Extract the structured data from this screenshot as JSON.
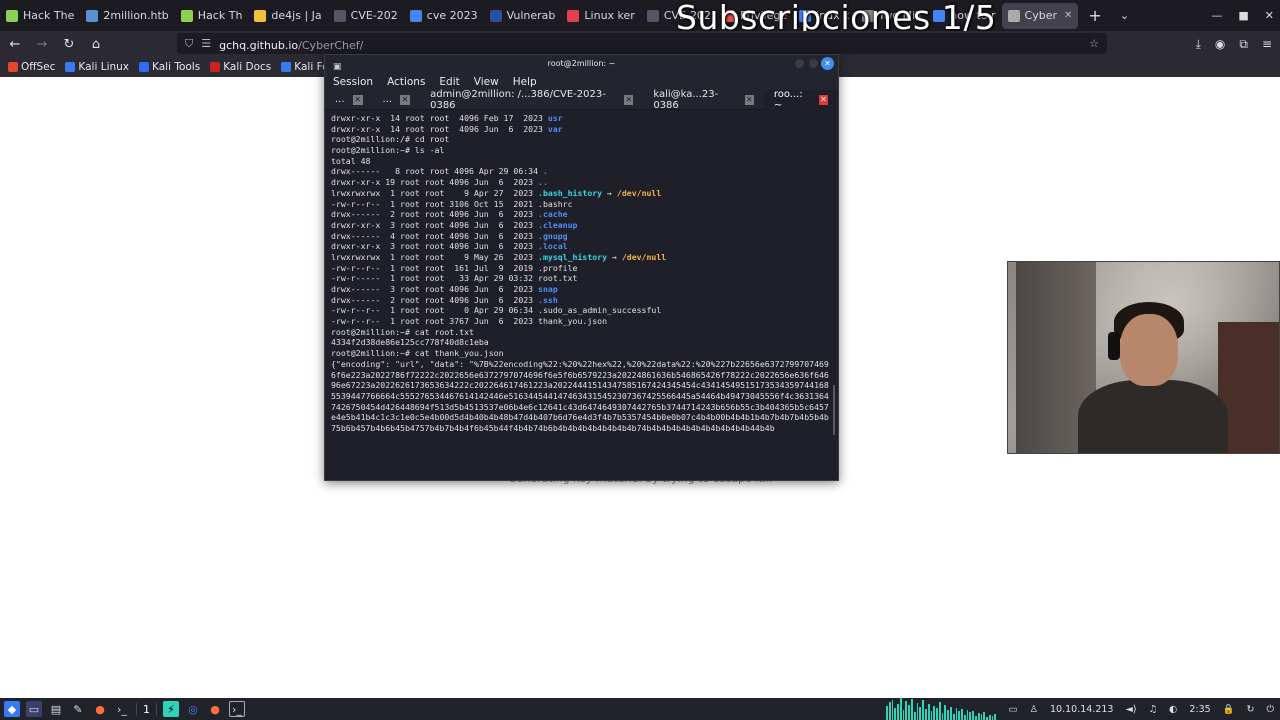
{
  "overlay": {
    "title": "Subscripciones 1/5"
  },
  "browser": {
    "tabs": [
      {
        "label": "Hack The",
        "color": "#8fd14f",
        "active": false
      },
      {
        "label": "2million.htb",
        "color": "#5a8fd0",
        "active": false
      },
      {
        "label": "Hack Th",
        "color": "#8fd14f",
        "active": false
      },
      {
        "label": "de4js | Ja",
        "color": "#f0c040",
        "active": false
      },
      {
        "label": "CVE-202",
        "color": "#555566",
        "active": false
      },
      {
        "label": "cve 2023",
        "color": "#4285f4",
        "active": false
      },
      {
        "label": "Vulnerab",
        "color": "#2a4ea0",
        "active": false
      },
      {
        "label": "Linux ker",
        "color": "#e04050",
        "active": false
      },
      {
        "label": "CVE-202",
        "color": "#555566",
        "active": false
      },
      {
        "label": "Privilege",
        "color": "#e05050",
        "active": false
      },
      {
        "label": "inux k",
        "color": "#4285f4",
        "active": false
      },
      {
        "label": "Two Mill",
        "color": "#888888",
        "active": false
      },
      {
        "label": "how to r",
        "color": "#4285f4",
        "active": false
      },
      {
        "label": "Cyber",
        "color": "#aaaaaa",
        "active": true
      }
    ],
    "url_host": "gchq.github.io",
    "url_path": "/CyberChef/",
    "bookmarks": [
      {
        "label": "OffSec",
        "color": "#e8452c"
      },
      {
        "label": "Kali Linux",
        "color": "#367bf0"
      },
      {
        "label": "Kali Tools",
        "color": "#2e6cf0"
      },
      {
        "label": "Kali Docs",
        "color": "#d02020"
      },
      {
        "label": "Kali Forums",
        "color": "#367bf0"
      }
    ]
  },
  "terminal": {
    "window_title": "root@2million: ~",
    "menu": [
      "Session",
      "Actions",
      "Edit",
      "View",
      "Help"
    ],
    "tabs": [
      {
        "label": "...",
        "active": false
      },
      {
        "label": "...",
        "active": false
      },
      {
        "label": "admin@2million: /...386/CVE-2023-0386",
        "active": false
      },
      {
        "label": "kali@ka...23-0386",
        "active": false
      },
      {
        "label": "roo...: ~",
        "active": true
      }
    ],
    "lines": [
      {
        "text": "drwxr-xr-x  14 root root  4096 Feb 17  2023 ",
        "name": "usr",
        "style": "blue",
        "arrow": "",
        "target": ""
      },
      {
        "text": "drwxr-xr-x  14 root root  4096 Jun  6  2023 ",
        "name": "var",
        "style": "blue",
        "arrow": "",
        "target": ""
      },
      {
        "text": "root@2million:/# cd root",
        "name": "",
        "style": "",
        "arrow": "",
        "target": ""
      },
      {
        "text": "root@2million:~# ls -al",
        "name": "",
        "style": "",
        "arrow": "",
        "target": ""
      },
      {
        "text": "total 48",
        "name": "",
        "style": "",
        "arrow": "",
        "target": ""
      },
      {
        "text": "drwx------   8 root root 4096 Apr 29 06:34 ",
        "name": ".",
        "style": "blue",
        "arrow": "",
        "target": ""
      },
      {
        "text": "drwxr-xr-x 19 root root 4096 Jun  6  2023 ",
        "name": "..",
        "style": "blue",
        "arrow": "",
        "target": ""
      },
      {
        "text": "lrwxrwxrwx  1 root root    9 Apr 27  2023 ",
        "name": ".bash_history",
        "style": "cyan",
        "arrow": " → ",
        "target": "/dev/null"
      },
      {
        "text": "-rw-r--r--  1 root root 3106 Oct 15  2021 .bashrc",
        "name": "",
        "style": "",
        "arrow": "",
        "target": ""
      },
      {
        "text": "drwx------  2 root root 4096 Jun  6  2023 ",
        "name": ".cache",
        "style": "blue",
        "arrow": "",
        "target": ""
      },
      {
        "text": "drwxr-xr-x  3 root root 4096 Jun  6  2023 ",
        "name": ".cleanup",
        "style": "blue",
        "arrow": "",
        "target": ""
      },
      {
        "text": "drwx------  4 root root 4096 Jun  6  2023 ",
        "name": ".gnupg",
        "style": "blue",
        "arrow": "",
        "target": ""
      },
      {
        "text": "drwxr-xr-x  3 root root 4096 Jun  6  2023 ",
        "name": ".local",
        "style": "blue",
        "arrow": "",
        "target": ""
      },
      {
        "text": "lrwxrwxrwx  1 root root    9 May 26  2023 ",
        "name": ".mysql_history",
        "style": "cyan",
        "arrow": " → ",
        "target": "/dev/null"
      },
      {
        "text": "-rw-r--r--  1 root root  161 Jul  9  2019 .profile",
        "name": "",
        "style": "",
        "arrow": "",
        "target": ""
      },
      {
        "text": "-rw-r-----  1 root root   33 Apr 29 03:32 root.txt",
        "name": "",
        "style": "",
        "arrow": "",
        "target": ""
      },
      {
        "text": "drwx------  3 root root 4096 Jun  6  2023 ",
        "name": "snap",
        "style": "blue",
        "arrow": "",
        "target": ""
      },
      {
        "text": "drwx------  2 root root 4096 Jun  6  2023 ",
        "name": ".ssh",
        "style": "blue",
        "arrow": "",
        "target": ""
      },
      {
        "text": "-rw-r--r--  1 root root    0 Apr 29 06:34 .sudo_as_admin_successful",
        "name": "",
        "style": "",
        "arrow": "",
        "target": ""
      },
      {
        "text": "-rw-r--r--  1 root root 3767 Jun  6  2023 thank_you.json",
        "name": "",
        "style": "",
        "arrow": "",
        "target": ""
      },
      {
        "text": "root@2million:~# cat root.txt",
        "name": "",
        "style": "",
        "arrow": "",
        "target": ""
      },
      {
        "text": "4334f2d38de86e125cc778f40d8c1eba",
        "name": "",
        "style": "",
        "arrow": "",
        "target": ""
      },
      {
        "text": "root@2million:~# cat thank_you.json",
        "name": "",
        "style": "",
        "arrow": "",
        "target": ""
      }
    ],
    "json_output": "{\"encoding\": \"url\", \"data\": \"%7B%22encoding%22:%20%22hex%22,%20%22data%22:%20%227b22656e63727997074696f6e223a2022786f72222c2022656e6372797074696f6e5f6b6579223a20224861636b546865426f78222c2022656e636f64696e67223a2022626173653634222c202264617461223a20224441514347585167424345454c434145495151735343597441685539447766664c555276534467614142446e5163445441474634315452307367425566445a54464b49473045556f4c36313647426750454d426448694f513d5b4513537e06b4e6c12641c43d6474649307442765b3744714243b656b55c3b404365b5c6457e4e5b41b4c1c3c1e0c5e4b00d5d4b40b4b48b47d4b407b6d76e4d3f4b7b5357454b0e0b07c4b4b00b4b4b1b4b7b4b7b4b5b4b75b6b457b4b6b45b4757b4b7b4b4f6b45b44f4b4b74b6b4b4b4b4b4b4b4b4b74b4b4b4b4b4b4b4b4b4b4b44b4b"
  },
  "behind_page": {
    "text": "Generating key material by trying to escape it..."
  },
  "taskbar": {
    "workspace": "1",
    "ip": "10.10.14.213",
    "time": "2:35"
  }
}
